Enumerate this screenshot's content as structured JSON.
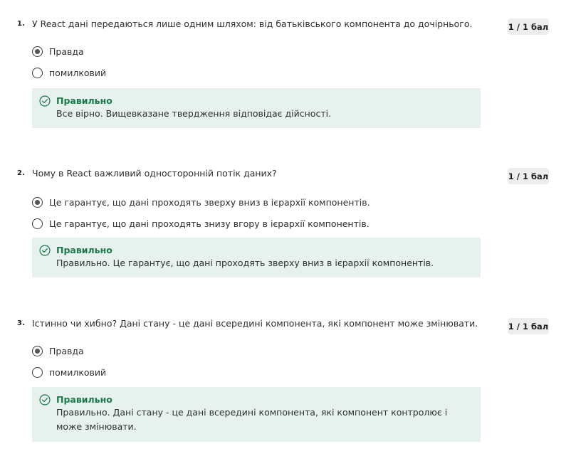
{
  "questions": [
    {
      "number": "1.",
      "text": "У React дані передаються лише одним шляхом: від батьківського компонента до дочірнього.",
      "score": "1 / 1 бал",
      "options": [
        {
          "label": "Правда",
          "selected": true
        },
        {
          "label": "помилковий",
          "selected": false
        }
      ],
      "feedback": {
        "title": "Правильно",
        "text": "Все вірно. Вищевказане твердження відповідає дійсності."
      }
    },
    {
      "number": "2.",
      "text": "Чому в React важливий односторонній потік даних?",
      "score": "1 / 1 бал",
      "options": [
        {
          "label": "Це гарантує, що дані проходять зверху вниз в ієрархії компонентів.",
          "selected": true
        },
        {
          "label": "Це гарантує, що дані проходять знизу вгору в ієрархії компонентів.",
          "selected": false
        }
      ],
      "feedback": {
        "title": "Правильно",
        "text": "Правильно. Це гарантує, що дані проходять зверху вниз в ієрархії компонентів."
      }
    },
    {
      "number": "3.",
      "text": "Істинно чи хибно? Дані стану - це дані всередині компонента, які компонент може змінювати.",
      "score": "1 / 1 бал",
      "options": [
        {
          "label": "Правда",
          "selected": true
        },
        {
          "label": "помилковий",
          "selected": false
        }
      ],
      "feedback": {
        "title": "Правильно",
        "text": "Правильно. Дані стану - це дані всередині компонента, які компонент контролює і може змінювати."
      }
    }
  ],
  "icons": {
    "feedback": "check-circle-icon"
  },
  "colors": {
    "correct": "#1b7a4c",
    "feedback_bg": "#e7f1ee",
    "score_bg": "#eeeeee"
  }
}
